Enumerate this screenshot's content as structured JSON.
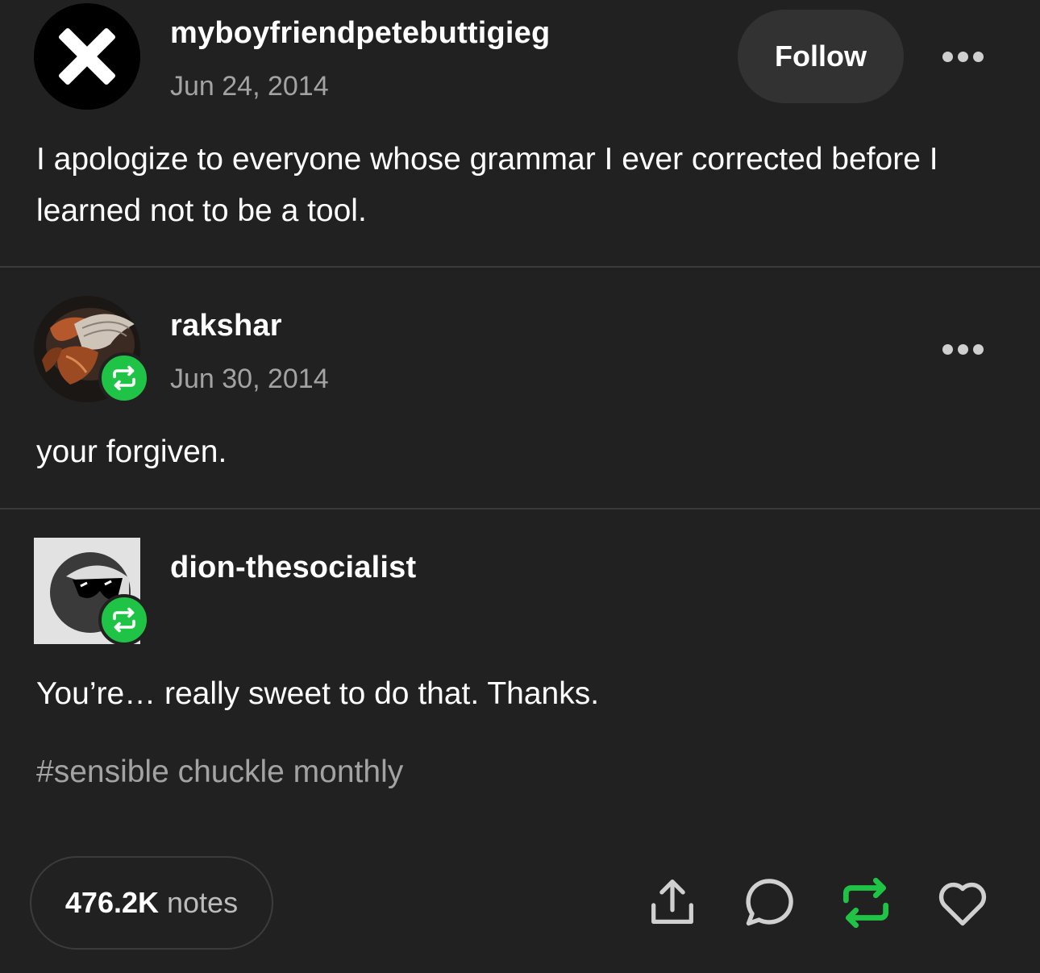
{
  "posts": [
    {
      "username": "myboyfriendpetebuttigieg",
      "date": "Jun 24, 2014",
      "follow_label": "Follow",
      "avatar_icon": "x-icon",
      "text": "I apologize to everyone whose grammar I ever corrected before I learned not to be a tool."
    },
    {
      "username": "rakshar",
      "date": "Jun 30, 2014",
      "avatar_icon": "winged-creature-avatar",
      "badge_icon": "reblog-icon",
      "text": "your forgiven."
    },
    {
      "username": "dion-thesocialist",
      "avatar_icon": "sunglasses-avatar",
      "badge_icon": "reblog-icon",
      "text": "You’re… really sweet to do that. Thanks.",
      "tag": "#sensible chuckle monthly"
    }
  ],
  "footer": {
    "notes_count": "476.2K",
    "notes_label": "notes",
    "actions": [
      "share-icon",
      "comment-icon",
      "reblog-icon",
      "heart-icon"
    ]
  },
  "colors": {
    "background": "#212121",
    "accent_green": "#1fc345",
    "muted_text": "#a3a3a3",
    "button_bg": "#323232"
  }
}
